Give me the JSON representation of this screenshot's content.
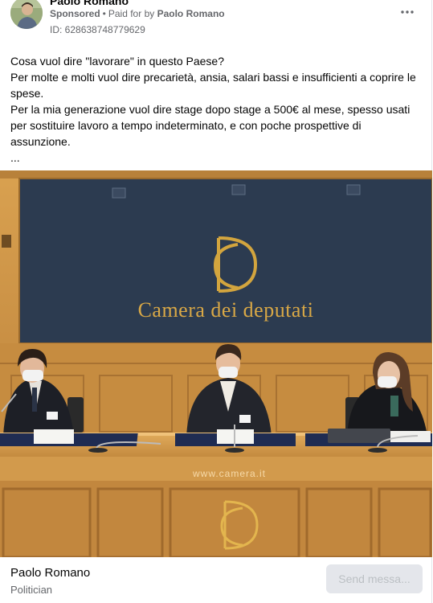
{
  "header": {
    "page_name": "Paolo Romano",
    "sponsored_label": "Sponsored",
    "separator": "•",
    "paid_for_prefix": "Paid for by",
    "paid_for_name": "Paolo Romano",
    "ad_id": "ID: 628638748779629",
    "more_icon": "more-horizontal-icon"
  },
  "post": {
    "paragraphs": [
      "Cosa vuol dire \"lavorare\" in questo Paese?",
      "Per molte e molti vuol dire precarietà, ansia, salari bassi e insufficienti a coprire le spese.",
      "Per la mia generazione vuol dire stage dopo stage a 500€ al mese, spesso usati per sostituire lavoro a tempo indeterminato, e con poche prospettive di assunzione.",
      "..."
    ]
  },
  "media": {
    "wall_text": "Camera dei deputati",
    "watermark": "www.camera.it"
  },
  "footer": {
    "name": "Paolo Romano",
    "subtitle": "Politician",
    "send_button": "Send messa..."
  },
  "colors": {
    "wall_blue": "#2c3c52",
    "wood": "#c99045",
    "gold": "#c89a35",
    "button_bg": "#e4e6eb",
    "secondary_text": "#65676b"
  }
}
